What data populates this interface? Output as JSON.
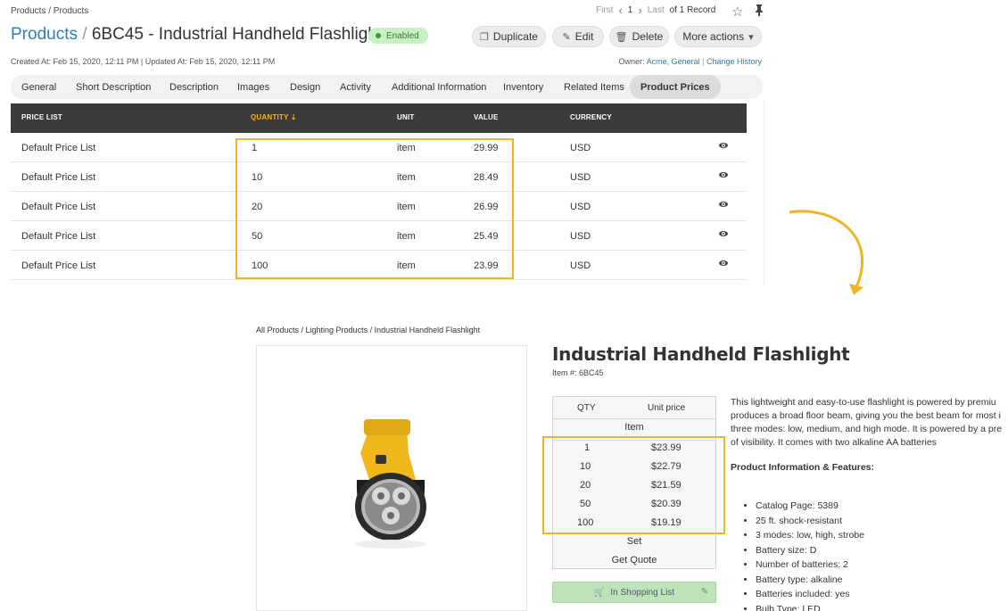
{
  "admin": {
    "breadcrumb": "Products / Products",
    "pager": {
      "first": "First",
      "page": "1",
      "last": "Last",
      "of": "of 1 Record"
    },
    "title_link": "Products",
    "title_sep": "/",
    "title_rest": "6BC45 - Industrial Handheld Flashlight",
    "status": "Enabled",
    "actions": {
      "duplicate": "Duplicate",
      "edit": "Edit",
      "delete": "Delete",
      "more": "More actions"
    },
    "meta": "Created At: Feb 15, 2020, 12:11 PM  |  Updated At: Feb 15, 2020, 12:11 PM",
    "owner_label": "Owner:",
    "owner_value": "Acme, General",
    "change_history": "Change History",
    "tabs": [
      "General",
      "Short Description",
      "Description",
      "Images",
      "Design",
      "Activity",
      "Additional Information",
      "Inventory",
      "Related Items",
      "Product Prices"
    ],
    "active_tab": "Product Prices",
    "grid": {
      "columns": [
        "PRICE LIST",
        "QUANTITY",
        "UNIT",
        "VALUE",
        "CURRENCY"
      ],
      "sorted_column": "QUANTITY",
      "rows": [
        {
          "price_list": "Default Price List",
          "quantity": "1",
          "unit": "item",
          "value": "29.99",
          "currency": "USD"
        },
        {
          "price_list": "Default Price List",
          "quantity": "10",
          "unit": "item",
          "value": "28.49",
          "currency": "USD"
        },
        {
          "price_list": "Default Price List",
          "quantity": "20",
          "unit": "item",
          "value": "26.99",
          "currency": "USD"
        },
        {
          "price_list": "Default Price List",
          "quantity": "50",
          "unit": "item",
          "value": "25.49",
          "currency": "USD"
        },
        {
          "price_list": "Default Price List",
          "quantity": "100",
          "unit": "item",
          "value": "23.99",
          "currency": "USD"
        }
      ]
    }
  },
  "storefront": {
    "breadcrumb": "All Products / Lighting Products / Industrial Handheld Flashlight",
    "title": "Industrial Handheld Flashlight",
    "item_number": "Item #: 6BC45",
    "price_table": {
      "qty_header": "QTY",
      "price_header": "Unit price",
      "unit_item": "Item",
      "rows": [
        {
          "qty": "1",
          "price": "$23.99"
        },
        {
          "qty": "10",
          "price": "$22.79"
        },
        {
          "qty": "20",
          "price": "$21.59"
        },
        {
          "qty": "50",
          "price": "$20.39"
        },
        {
          "qty": "100",
          "price": "$19.19"
        }
      ],
      "unit_set": "Set",
      "get_quote": "Get Quote"
    },
    "shopping_list_button": "In Shopping List",
    "description_lines": [
      "This lightweight and easy-to-use flashlight is powered by premiu",
      "produces a broad floor beam, giving you the best beam for most i",
      "three modes: low, medium, and high mode. It is powered by a pre",
      "of visibility. It comes with two alkaline AA batteries"
    ],
    "features_heading": "Product Information & Features:",
    "features": [
      "Catalog Page: 5389",
      "25 ft. shock-resistant",
      "3 modes: low, high, strobe",
      "Battery size: D",
      "Number of batteries: 2",
      "Battery type: alkaline",
      "Batteries included: yes",
      "Bulb Type: LED"
    ]
  },
  "colors": {
    "highlight": "#f0b429",
    "link": "#2f7db3",
    "grid_header": "#3b3b3b",
    "enabled_badge": "#c9f0c4"
  }
}
